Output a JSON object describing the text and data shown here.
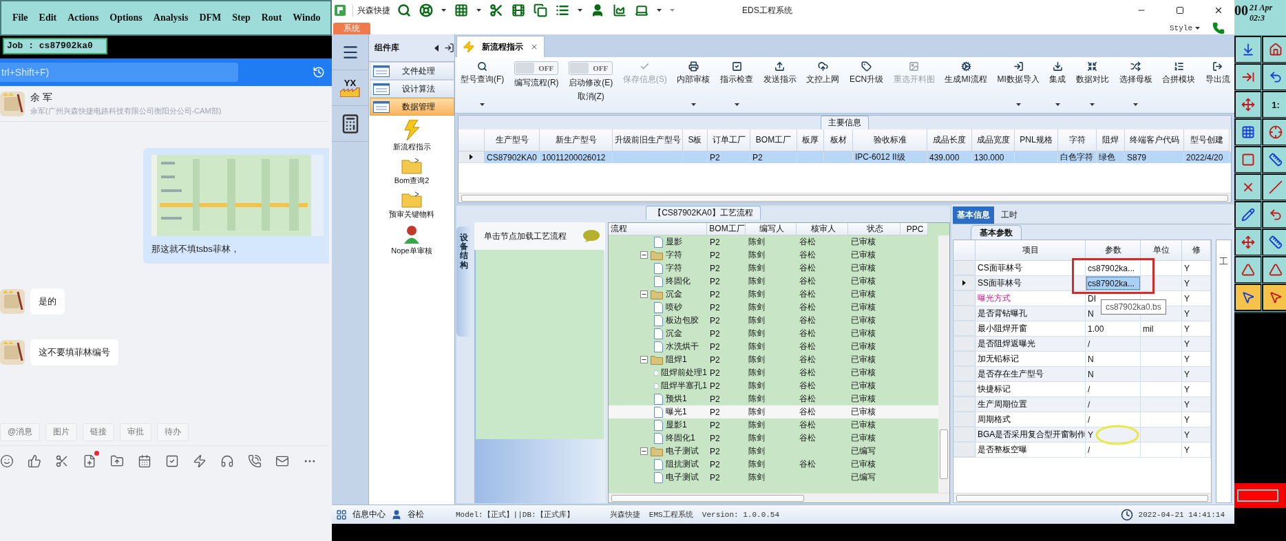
{
  "cam_menu": [
    "File",
    "Edit",
    "Actions",
    "Options",
    "Analysis",
    "DFM",
    "Step",
    "Rout",
    "Windo"
  ],
  "cam_job": "Job : cs87902ka0",
  "chat": {
    "search": {
      "placeholder": "trl+Shift+F)"
    },
    "contact": {
      "name": "余 军",
      "subtitle": "余军(广州兴森快捷电路科技有限公司衡阳分公司-CAM部)"
    },
    "messages": [
      {
        "kind": "outgoing",
        "text": "那这就不填tsbs菲林，"
      },
      {
        "kind": "incoming",
        "text": "是的"
      },
      {
        "kind": "incoming",
        "text": "这不要填菲林编号"
      }
    ],
    "chips": [
      "@消息",
      "图片",
      "链接",
      "审批",
      "待办"
    ],
    "tools": [
      {
        "kind": "smile",
        "notified": false
      },
      {
        "kind": "like",
        "notified": false
      },
      {
        "kind": "cut",
        "notified": false
      },
      {
        "kind": "note",
        "notified": true
      },
      {
        "kind": "upload",
        "notified": false
      },
      {
        "kind": "calendar",
        "notified": false
      },
      {
        "kind": "task",
        "notified": false
      },
      {
        "kind": "flash",
        "notified": false
      },
      {
        "kind": "headset",
        "notified": false
      },
      {
        "kind": "call",
        "notified": false
      },
      {
        "kind": "mail",
        "notified": false
      },
      {
        "kind": "more",
        "notified": false
      }
    ]
  },
  "eds": {
    "brand": "兴森快捷",
    "title": "EDS工程系统",
    "app_tab": "系统",
    "style_menu": "Style",
    "logo_text": "YX",
    "nav": {
      "title": "组件库",
      "items": [
        {
          "label": "文件处理",
          "selected": false
        },
        {
          "label": "设计算法",
          "selected": false
        },
        {
          "label": "数据管理",
          "selected": true
        }
      ],
      "launchers": [
        {
          "label": "新流程指示",
          "kind": "lightning"
        },
        {
          "label": "Bom查询2",
          "kind": "folder"
        },
        {
          "label": "预审关键物料",
          "kind": "folder"
        },
        {
          "label": "Nope单审核",
          "kind": "person"
        }
      ]
    },
    "doc_tabs": [
      {
        "label": "新流程指示",
        "selected": true
      }
    ],
    "ribbon": [
      {
        "kind": "button",
        "label": "型号查询(F)",
        "dropdown": true,
        "disabled": false
      },
      {
        "kind": "toggle",
        "label": "编写流程(R)",
        "toggle_text": "OFF",
        "on": false
      },
      {
        "kind": "toggle",
        "label": "启动修改(E)",
        "sublabel": "取消(Z)",
        "toggle_text": "OFF",
        "on": false
      },
      {
        "kind": "button",
        "label": "保存信息(S)",
        "dropdown": false,
        "disabled": true
      },
      {
        "kind": "button",
        "label": "内部审核",
        "dropdown": true,
        "disabled": false
      },
      {
        "kind": "button",
        "label": "指示检查",
        "dropdown": true,
        "disabled": false
      },
      {
        "kind": "button",
        "label": "发送指示",
        "dropdown": false,
        "disabled": false
      },
      {
        "kind": "button",
        "label": "文控上网",
        "dropdown": false,
        "disabled": false
      },
      {
        "kind": "button",
        "label": "ECN升级",
        "dropdown": false,
        "disabled": false
      },
      {
        "kind": "button",
        "label": "重选开料图",
        "dropdown": false,
        "disabled": true
      },
      {
        "kind": "button",
        "label": "生成MI流程",
        "dropdown": false,
        "disabled": false
      },
      {
        "kind": "button",
        "label": "MI数据导入",
        "dropdown": true,
        "disabled": false
      },
      {
        "kind": "button",
        "label": "集成",
        "dropdown": true,
        "disabled": false
      },
      {
        "kind": "button",
        "label": "数据对比",
        "dropdown": true,
        "disabled": false
      },
      {
        "kind": "button",
        "label": "选择母板",
        "dropdown": true,
        "disabled": false
      },
      {
        "kind": "button",
        "label": "合拼模块",
        "dropdown": false,
        "disabled": false
      },
      {
        "kind": "button",
        "label": "导出流",
        "dropdown": false,
        "disabled": false
      }
    ],
    "main_info": {
      "title": "主要信息",
      "columns": [
        "生产型号",
        "新生产型号",
        "升级前旧生产型号",
        "S板",
        "订单工厂",
        "BOM工厂",
        "板厚",
        "板材",
        "验收标准",
        "成品长度",
        "成品宽度",
        "PNL规格",
        "字符",
        "阻焊",
        "终端客户代码",
        "型号创建"
      ],
      "rows": [
        {
          "selected": true,
          "cells": [
            "CS87902KA0",
            "10011200026012",
            "",
            "",
            "P2",
            "P2",
            "",
            "",
            "IPC-6012 II级",
            "439.000",
            "130.000",
            "",
            "白色字符",
            "绿色",
            "S879",
            "2022/4/20"
          ]
        }
      ]
    },
    "process": {
      "title": "【CS87902KA0】工艺流程",
      "side_tab": "设备结构",
      "hint": "单击节点加载工艺流程",
      "columns": [
        "流程",
        "BOM工厂",
        "编写人",
        "核审人",
        "状态",
        "PPC"
      ],
      "continued": [
        {
          "name": "显影",
          "bom": "P2",
          "writer": "陈剑",
          "reviewer": "谷松",
          "status": "已审核",
          "selected": false
        }
      ],
      "nodes": [
        {
          "name": "字符",
          "bom": "P2",
          "writer": "陈剑",
          "reviewer": "谷松",
          "status": "已审核",
          "selected": false,
          "expanded": true,
          "children": [
            {
              "name": "字符",
              "bom": "P2",
              "writer": "陈剑",
              "reviewer": "谷松",
              "status": "已审核",
              "selected": false
            },
            {
              "name": "终固化",
              "bom": "P2",
              "writer": "陈剑",
              "reviewer": "谷松",
              "status": "已审核",
              "selected": false
            }
          ]
        },
        {
          "name": "沉金",
          "bom": "P2",
          "writer": "陈剑",
          "reviewer": "谷松",
          "status": "已审核",
          "selected": false,
          "expanded": true,
          "children": [
            {
              "name": "喷砂",
              "bom": "P2",
              "writer": "陈剑",
              "reviewer": "谷松",
              "status": "已审核",
              "selected": false
            },
            {
              "name": "板边包胶",
              "bom": "P2",
              "writer": "陈剑",
              "reviewer": "谷松",
              "status": "已审核",
              "selected": false
            },
            {
              "name": "沉金",
              "bom": "P2",
              "writer": "陈剑",
              "reviewer": "谷松",
              "status": "已审核",
              "selected": false
            },
            {
              "name": "水洗烘干",
              "bom": "P2",
              "writer": "陈剑",
              "reviewer": "谷松",
              "status": "已审核",
              "selected": false
            }
          ]
        },
        {
          "name": "阻焊1",
          "bom": "P2",
          "writer": "陈剑",
          "reviewer": "谷松",
          "status": "已审核",
          "selected": false,
          "expanded": true,
          "children": [
            {
              "name": "阻焊前处理1",
              "bom": "P2",
              "writer": "陈剑",
              "reviewer": "谷松",
              "status": "已审核",
              "selected": false
            },
            {
              "name": "阻焊半塞孔1",
              "bom": "P2",
              "writer": "陈剑",
              "reviewer": "谷松",
              "status": "已审核",
              "selected": false
            },
            {
              "name": "预烘1",
              "bom": "P2",
              "writer": "陈剑",
              "reviewer": "谷松",
              "status": "已审核",
              "selected": false
            },
            {
              "name": "曝光1",
              "bom": "P2",
              "writer": "陈剑",
              "reviewer": "谷松",
              "status": "已审核",
              "selected": true
            },
            {
              "name": "显影1",
              "bom": "P2",
              "writer": "陈剑",
              "reviewer": "谷松",
              "status": "已审核",
              "selected": false
            },
            {
              "name": "终固化1",
              "bom": "P2",
              "writer": "陈剑",
              "reviewer": "谷松",
              "status": "已审核",
              "selected": false
            }
          ]
        },
        {
          "name": "电子测试",
          "bom": "P2",
          "writer": "陈剑",
          "status": "已编写",
          "selected": false,
          "expanded": true,
          "children": [
            {
              "name": "阻抗测试",
              "bom": "P2",
              "writer": "陈剑",
              "reviewer": "谷松",
              "status": "已审核",
              "selected": false
            },
            {
              "name": "电子测试",
              "bom": "P2",
              "writer": "陈剑",
              "status": "已编写",
              "selected": false
            }
          ]
        }
      ]
    },
    "params": {
      "tabs": [
        {
          "label": "基本信息",
          "selected": true
        },
        {
          "label": "工时",
          "selected": false
        }
      ],
      "subtab": "基本参数",
      "side_label": "工",
      "columns": [
        "项目",
        "参数",
        "单位",
        "修"
      ],
      "rows": [
        {
          "item": "CS面菲林号",
          "value": "cs87902ka...",
          "modify": "Y",
          "selected": false,
          "emphasis": false
        },
        {
          "item": "SS面菲林号",
          "value": "cs87902ka...",
          "modify": "Y",
          "selected": true,
          "emphasis": false
        },
        {
          "item": "曝光方式",
          "value": "DI",
          "modify": "Y",
          "selected": false,
          "emphasis": true
        },
        {
          "item": "是否背钻曝孔",
          "value": "N",
          "modify": "Y",
          "selected": false,
          "emphasis": false
        },
        {
          "item": "最小阻焊开窗",
          "value": "1.00",
          "unit": "mil",
          "modify": "Y",
          "selected": false,
          "emphasis": false
        },
        {
          "item": "是否阻焊返曝光",
          "value": "/",
          "modify": "Y",
          "selected": false,
          "emphasis": false
        },
        {
          "item": "加无铅标记",
          "value": "N",
          "modify": "Y",
          "selected": false,
          "emphasis": false
        },
        {
          "item": "是否存在生产型号",
          "value": "N",
          "modify": "Y",
          "selected": false,
          "emphasis": false
        },
        {
          "item": "快捷标记",
          "value": "/",
          "modify": "Y",
          "selected": false,
          "emphasis": false
        },
        {
          "item": "生产周期位置",
          "value": "/",
          "modify": "Y",
          "selected": false,
          "emphasis": false
        },
        {
          "item": "周期格式",
          "value": "/",
          "modify": "Y",
          "selected": false,
          "emphasis": false
        },
        {
          "item": "BGA是否采用复合型开窗制作",
          "value": "Y",
          "modify": "Y",
          "selected": false,
          "emphasis": false
        },
        {
          "item": "是否整板空曝",
          "value": "/",
          "modify": "Y",
          "selected": false,
          "emphasis": false
        }
      ],
      "tooltip": "cs87902ka0.bs",
      "annotations": [
        {
          "kind": "rectangle"
        },
        {
          "kind": "ellipse"
        }
      ]
    },
    "status_bar": {
      "info": "信息中心",
      "user": "谷松",
      "model": "Model:【正式】||DB:【正式库】",
      "version": "兴森快捷  EMS工程系统  Version: 1.0.0.54",
      "time": "2022-04-21 14:41:14"
    }
  },
  "cam_side": {
    "clock": [
      "00",
      "21 Apr",
      "02:3"
    ],
    "tool_label": "1:"
  }
}
